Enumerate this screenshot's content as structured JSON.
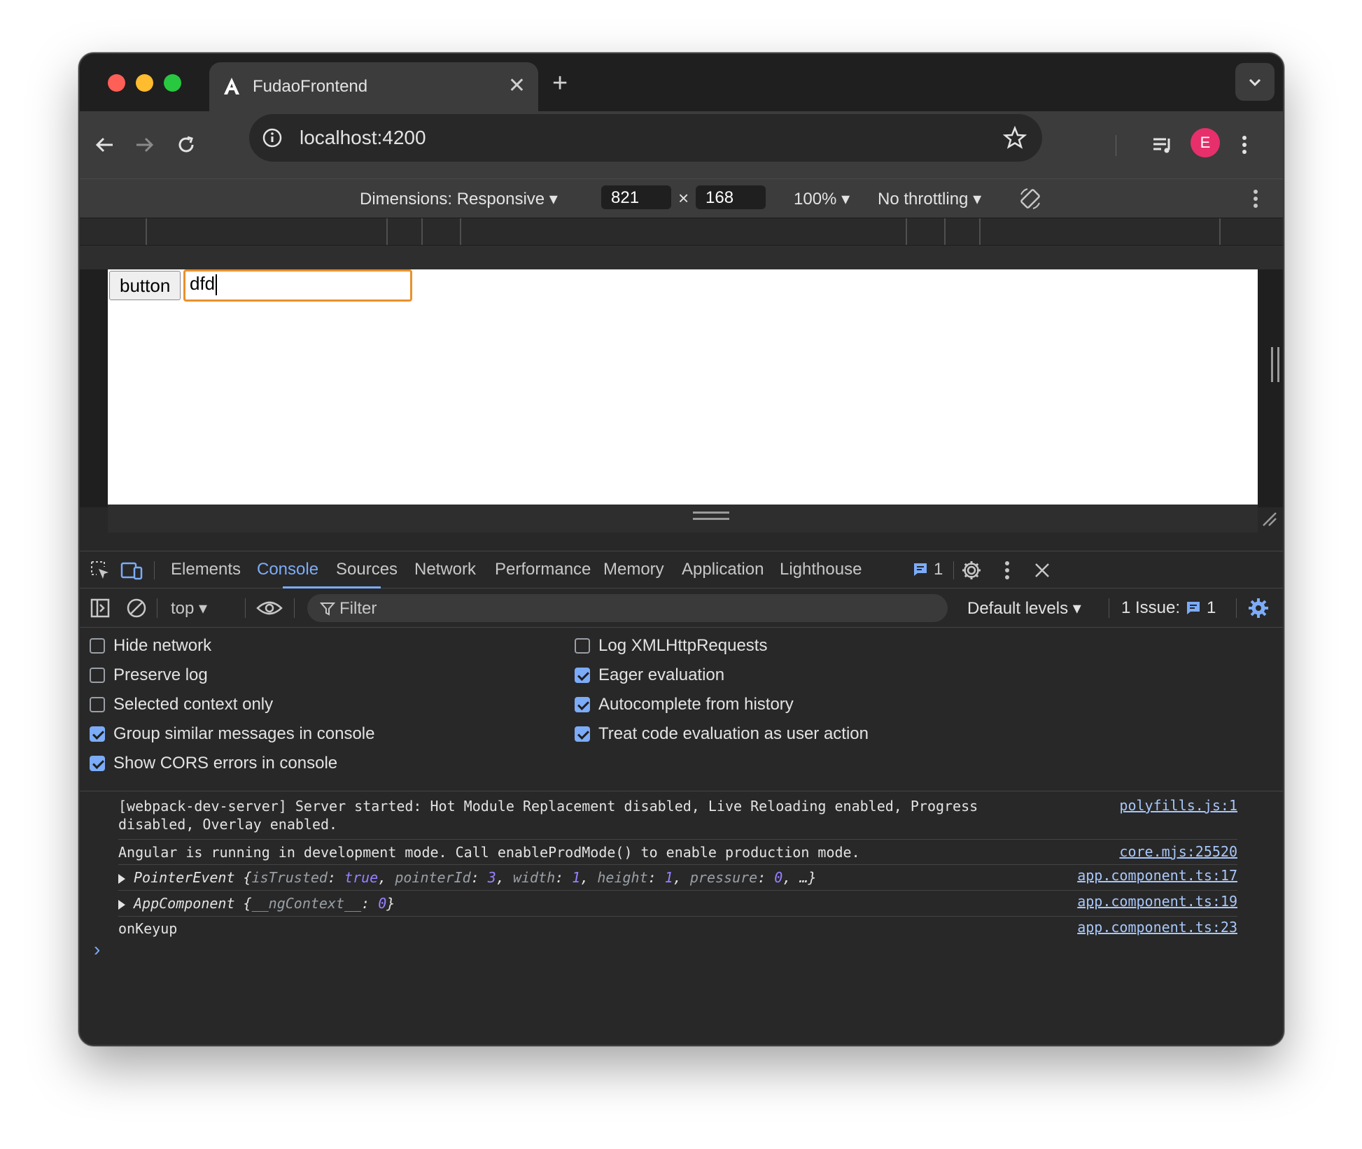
{
  "browser": {
    "tab_title": "FudaoFrontend",
    "url": "localhost:4200",
    "avatar_letter": "E"
  },
  "device_toolbar": {
    "dimensions_label": "Dimensions: Responsive",
    "width": "821",
    "height": "168",
    "times": "×",
    "zoom": "100%",
    "throttling": "No throttling"
  },
  "page": {
    "button_label": "button",
    "input_value": "dfd"
  },
  "devtools": {
    "tabs": [
      "Elements",
      "Console",
      "Sources",
      "Network",
      "Performance",
      "Memory",
      "Application",
      "Lighthouse"
    ],
    "active_tab": "Console",
    "message_count": "1",
    "context": "top",
    "filter_placeholder": "Filter",
    "levels": "Default levels",
    "issues_label": "1 Issue:",
    "issues_count": "1"
  },
  "settings": {
    "left": [
      {
        "label": "Hide network",
        "checked": false
      },
      {
        "label": "Preserve log",
        "checked": false
      },
      {
        "label": "Selected context only",
        "checked": false
      },
      {
        "label": "Group similar messages in console",
        "checked": true
      },
      {
        "label": "Show CORS errors in console",
        "checked": true
      }
    ],
    "right": [
      {
        "label": "Log XMLHttpRequests",
        "checked": false
      },
      {
        "label": "Eager evaluation",
        "checked": true
      },
      {
        "label": "Autocomplete from history",
        "checked": true
      },
      {
        "label": "Treat code evaluation as user action",
        "checked": true
      }
    ]
  },
  "console": {
    "messages": [
      {
        "text_line1": "[webpack-dev-server] Server started: Hot Module Replacement disabled, Live Reloading enabled, Progress",
        "text_line2": "disabled, Overlay enabled.",
        "source": "polyfills.js:1"
      },
      {
        "text": "Angular is running in development mode. Call enableProdMode() to enable production mode.",
        "source": "core.mjs:25520"
      },
      {
        "object": "PointerEvent",
        "props": [
          {
            "k": "isTrusted",
            "v": "true"
          },
          {
            "k": "pointerId",
            "v": "3"
          },
          {
            "k": "width",
            "v": "1"
          },
          {
            "k": "height",
            "v": "1"
          },
          {
            "k": "pressure",
            "v": "0"
          }
        ],
        "ellipsis": "…}",
        "source": "app.component.ts:17"
      },
      {
        "object": "AppComponent",
        "props": [
          {
            "k": "__ngContext__",
            "v": "0"
          }
        ],
        "source": "app.component.ts:19"
      },
      {
        "text": "onKeyup",
        "source": "app.component.ts:23"
      }
    ],
    "prompt": "›"
  }
}
